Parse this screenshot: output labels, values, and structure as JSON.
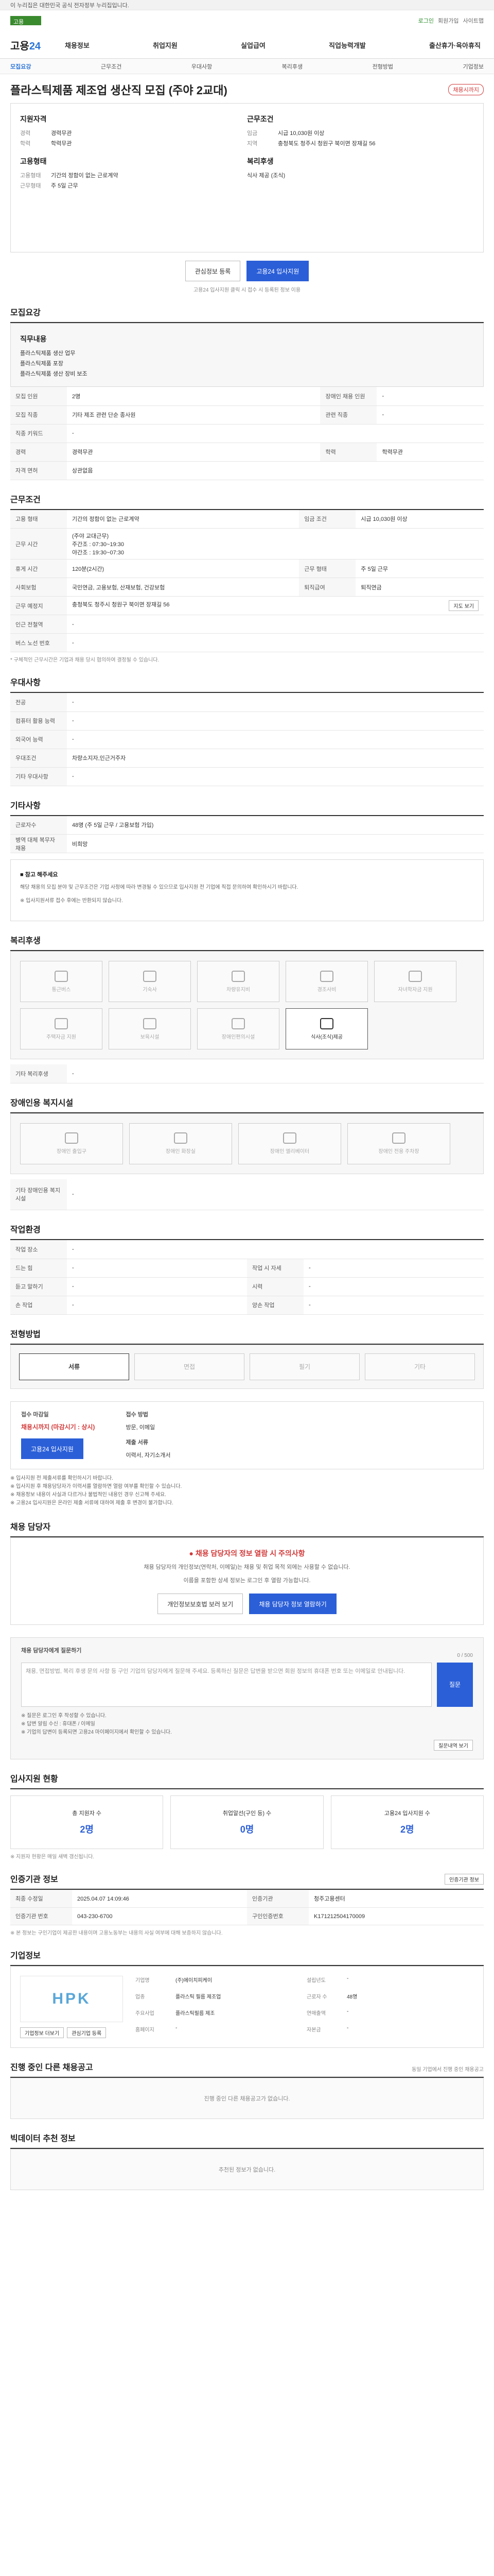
{
  "gov_bar": {
    "text": "이 누리집은 대한민국 공식 전자정부 누리집입니다."
  },
  "top": {
    "brand_label": "고용",
    "links": [
      "로그인",
      "회원가입",
      "사이트맵"
    ]
  },
  "gnb": {
    "logo_main": "고용",
    "logo_accent": "24",
    "menu": [
      "채용정보",
      "취업지원",
      "실업급여",
      "직업능력개발",
      "출산휴가·육아휴직"
    ]
  },
  "sub_nav": {
    "items": [
      "모집요강",
      "근무조건",
      "우대사항",
      "복리후생",
      "전형방법",
      "기업정보"
    ]
  },
  "job": {
    "title": "플라스틱제품 제조업 생산직 모집 (주야 2교대)",
    "status_badge": "채용시까지",
    "qualification_head": "지원자격",
    "qualification": [
      {
        "k": "경력",
        "v": "경력무관"
      },
      {
        "k": "학력",
        "v": "학력무관"
      }
    ],
    "conditions_head": "근무조건",
    "conditions": [
      {
        "k": "임금",
        "v": "시급 10,030원 이상"
      },
      {
        "k": "지역",
        "v": "충청북도 청주시 청원구 북이면 장재길 56"
      }
    ],
    "form_head": "고용형태",
    "form": [
      {
        "k": "고용형태",
        "v": "기간의 정함이 없는 근로계약"
      },
      {
        "k": "근무형태",
        "v": "주 5일 근무"
      }
    ],
    "welfare_head": "복리후생",
    "welfare": [
      {
        "k": "",
        "v": "식사 제공 (조식)"
      }
    ],
    "btn_interest": "관심정보 등록",
    "btn_apply": "고용24 입사지원",
    "btn_note": "고용24 입사지원 클릭 시 접수 시 등록된 정보 이용"
  },
  "recruit": {
    "title": "모집요강",
    "panel_head": "직무내용",
    "panel_lines": [
      "플라스틱제품 생산 업무",
      "플라스틱제품 포장",
      "플라스틱제품 생산 장비 보조"
    ],
    "rows": [
      {
        "k": "모집 인원",
        "v": "2명",
        "k2": "장애인 채용 인원",
        "v2": "-"
      },
      {
        "k": "모집 직종",
        "v": "기타 제조 관련 단순 종사원",
        "k2": "관련 직종",
        "v2": "-"
      },
      {
        "k": "직종 키워드",
        "v": "-",
        "k2": "",
        "v2": ""
      },
      {
        "k": "경력",
        "v": "경력무관",
        "k2": "학력",
        "v2": "학력무관"
      },
      {
        "k": "자격 면허",
        "v": "상관없음",
        "k2": "",
        "v2": ""
      }
    ]
  },
  "work": {
    "title": "근무조건",
    "rows": [
      {
        "k": "고용 형태",
        "v": "기간의 정함이 없는 근로계약",
        "k2": "임금 조건",
        "v2": "시급 10,030원 이상"
      },
      {
        "k": "근무 시간",
        "v": "(주야 교대근무)\n주간조 : 07:30~19:30\n야간조 : 19:30~07:30",
        "k2": "",
        "v2": ""
      },
      {
        "k": "휴게 시간",
        "v": "120분(2시간)",
        "k2": "근무 형태",
        "v2": "주 5일 근무"
      },
      {
        "k": "사회보험",
        "v": "국민연금, 고용보험, 산재보험, 건강보험",
        "k2": "퇴직급여",
        "v2": "퇴직연금"
      },
      {
        "k": "근무 예정지",
        "v": "충청북도 청주시 청원구 북이면 장재길 56",
        "k2": "",
        "v2": ""
      },
      {
        "k": "인근 전철역",
        "v": "-",
        "k2": "",
        "v2": ""
      },
      {
        "k": "버스 노선 번호",
        "v": "-",
        "k2": "",
        "v2": ""
      }
    ],
    "map_btn": "지도 보기",
    "note": "* 구체적인 근무시간은 기업과 채용 당시 협의하여 결정될 수 있습니다."
  },
  "pref": {
    "title": "우대사항",
    "rows": [
      {
        "k": "전공",
        "v": "-"
      },
      {
        "k": "컴퓨터 활용 능력",
        "v": "-"
      },
      {
        "k": "외국어 능력",
        "v": "-"
      },
      {
        "k": "우대조건",
        "v": "차량소지자,인근거주자"
      },
      {
        "k": "기타 우대사항",
        "v": "-"
      }
    ]
  },
  "selection": {
    "title": "기타사항",
    "rows": [
      {
        "k": "근로자수",
        "v": "48명 (주 5일 근무 / 고용보험 가입)"
      },
      {
        "k": "병역 대체 복무자 채용",
        "v": "비희망"
      }
    ],
    "notice_head": "■ 참고 해주세요",
    "notice_text": "해당 채용의 모집 분야 및 근무조건은 기업 사정에 따라 변경될 수 있으므로 입사지원 전 기업에 직접 문의하여 확인하시기 바랍니다.",
    "notice_text2": "※ 입사지원서류 접수 후에는 반환되지 않습니다."
  },
  "benefit": {
    "title": "복리후생",
    "items": [
      {
        "label": "통근버스",
        "on": false
      },
      {
        "label": "기숙사",
        "on": false
      },
      {
        "label": "차량유지비",
        "on": false
      },
      {
        "label": "경조사비",
        "on": false
      },
      {
        "label": "자녀학자금 지원",
        "on": false
      },
      {
        "label": "주택자금 지원",
        "on": false
      },
      {
        "label": "보육시설",
        "on": false
      },
      {
        "label": "장애인편의시설",
        "on": false
      },
      {
        "label": "식사(조식)제공",
        "on": true
      }
    ],
    "other_label": "기타 복리후생",
    "other_value": "-"
  },
  "disabled": {
    "title": "장애인용 복지시설",
    "items": [
      "장애인 출입구",
      "장애인 화장실",
      "장애인 엘리베이터",
      "장애인 전용 주차장"
    ],
    "other_label": "기타 장애인용 복지시설",
    "other_value": "-"
  },
  "env": {
    "title": "작업환경",
    "rows": [
      {
        "k": "작업 장소",
        "v": "-",
        "k2": "",
        "v2": ""
      },
      {
        "k": "드는 힘",
        "v": "-",
        "k2": "작업 시 자세",
        "v2": "-"
      },
      {
        "k": "듣고 말하기",
        "v": "-",
        "k2": "시력",
        "v2": "-"
      },
      {
        "k": "손 작업",
        "v": "-",
        "k2": "양손 작업",
        "v2": "-"
      }
    ]
  },
  "process": {
    "title": "전형방법",
    "steps": [
      {
        "label": "서류",
        "on": true
      },
      {
        "label": "면접",
        "on": false
      },
      {
        "label": "필기",
        "on": false
      },
      {
        "label": "기타",
        "on": false
      }
    ]
  },
  "apply": {
    "deadline_head": "접수 마감일",
    "deadline": "채용시까지 (마감시기 : 상시)",
    "method_head": "접수 방법",
    "method": "방문, 이메일",
    "docs_head": "제출 서류",
    "docs": "이력서, 자기소개서",
    "btn": "고용24 입사지원",
    "notes": [
      "※ 입사지원 전 제출서류를 확인하시기 바랍니다.",
      "※ 입사지원 후 채용담당자가 이력서를 열람하면 열람 여부를 확인할 수 있습니다.",
      "※ 채용정보 내용이 사실과 다르거나 불법적인 내용인 경우 신고해 주세요.",
      "※ 고용24 입사지원은 온라인 제출 서류에 대하여 제출 후 변경이 불가합니다."
    ]
  },
  "manager": {
    "title": "채용 담당자",
    "warn": "채용 담당자의 정보 열람 시 주의사항",
    "text1": "채용 담당자의 개인정보(연락처, 이메일)는 채용 및 취업 목적 외에는 사용할 수 없습니다.",
    "text2": "이름을 포함한 상세 정보는 로그인 후 열람 가능합니다.",
    "btn_privacy": "개인정보보호법 보러 보기",
    "btn_view": "채용 담당자 정보 열람하기"
  },
  "inquiry": {
    "title": "채용 담당자에게 질문하기",
    "counter": "0 / 500",
    "placeholder": "채용, 면접방법, 복리 후생 문의 사항 등 구인 기업의 담당자에게 질문해 주세요. 등록하신 질문은 답변을 받으면 회원 정보의 휴대폰 번호 또는 이메일로 안내됩니다.",
    "send": "질문",
    "notes": [
      "※ 질문은 로그인 후 작성할 수 있습니다.",
      "※ 답변 알림 수신 : 휴대폰 / 이메일",
      "※ 기업의 답변이 등록되면 고용24 마이페이지에서 확인할 수 있습니다."
    ],
    "history_btn": "질문내역 보기"
  },
  "stats": {
    "title": "입사지원 현황",
    "cards": [
      {
        "label": "총 지원자 수",
        "value": "2명"
      },
      {
        "label": "취업알선(구인 등) 수",
        "value": "0명"
      },
      {
        "label": "고용24 입사지원 수",
        "value": "2명"
      }
    ],
    "note": "※ 지원자 현황은 매일 새벽 갱신됩니다."
  },
  "reg": {
    "title": "인증기관 정보",
    "btn": "인증기관 정보",
    "rows": [
      {
        "k": "최종 수정일",
        "v": "2025.04.07 14:09:46",
        "k2": "인증기관",
        "v2": "청주고용센터"
      },
      {
        "k": "인증기관 번호",
        "v": "043-230-6700",
        "k2": "구인인증번호",
        "v2": "K171212504170009"
      }
    ],
    "note": "※ 본 정보는 구인기업이 제공한 내용이며 고용노동부는 내용의 사실 여부에 대해 보증하지 않습니다."
  },
  "company": {
    "title": "기업정보",
    "logo": "HPK",
    "info": [
      {
        "k": "기업명",
        "v": "(주)에이치피케이"
      },
      {
        "k": "업종",
        "v": "플라스틱 필름 제조업"
      },
      {
        "k": "주요사업",
        "v": "플라스틱필름 제조"
      },
      {
        "k": "홈페이지",
        "v": "-"
      },
      {
        "k": "설립년도",
        "v": "-"
      },
      {
        "k": "근로자 수",
        "v": "48명"
      },
      {
        "k": "연매출액",
        "v": "-"
      },
      {
        "k": "자본금",
        "v": "-"
      }
    ],
    "btn_other": "기업정보 더보기",
    "btn_follow": "관심기업 등록"
  },
  "other_jobs": {
    "title": "진행 중인 다른 채용공고",
    "aside": "동일 기업에서 진행 중인 채용공고",
    "empty": "진행 중인 다른 채용공고가 없습니다."
  },
  "recommend": {
    "title": "빅데이터 추천 정보",
    "empty": "추천된 정보가 없습니다."
  }
}
